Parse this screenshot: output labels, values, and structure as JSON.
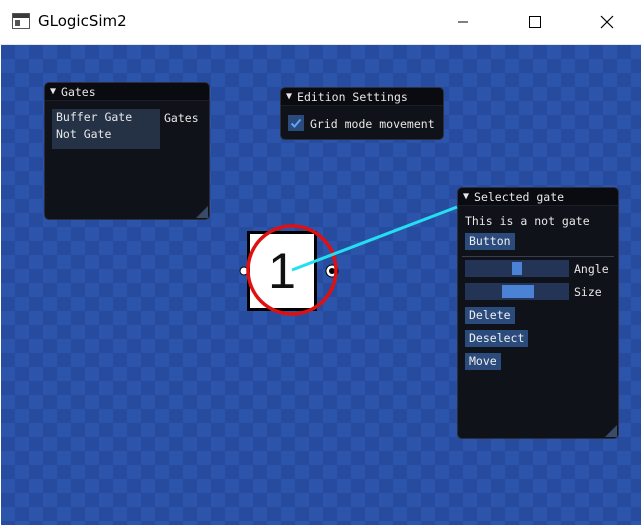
{
  "window": {
    "title": "GLogicSim2",
    "controls": [
      "minimize",
      "maximize",
      "close"
    ]
  },
  "gates_panel": {
    "title": "Gates",
    "items": [
      "Buffer Gate",
      "Not Gate"
    ],
    "list_label": "Gates"
  },
  "edition_panel": {
    "title": "Edition Settings",
    "grid_mode_label": "Grid mode movement",
    "grid_mode_checked": true
  },
  "selected_panel": {
    "title": "Selected gate",
    "description": "This is a not gate",
    "button_label": "Button",
    "angle_label": "Angle",
    "angle_value": 0.5,
    "size_label": "Size",
    "size_value": 0.5,
    "delete_label": "Delete",
    "deselect_label": "Deselect",
    "move_label": "Move"
  },
  "gate": {
    "label": "1",
    "type": "not",
    "selected": true
  },
  "colors": {
    "canvas_dark": "#274c9f",
    "canvas_light": "#2d54ab",
    "panel_bg": "#101219",
    "button_bg": "#2a4b7c",
    "accent": "#4b82d6",
    "selection_ring": "#e01010",
    "link_line": "#22e0f0"
  }
}
